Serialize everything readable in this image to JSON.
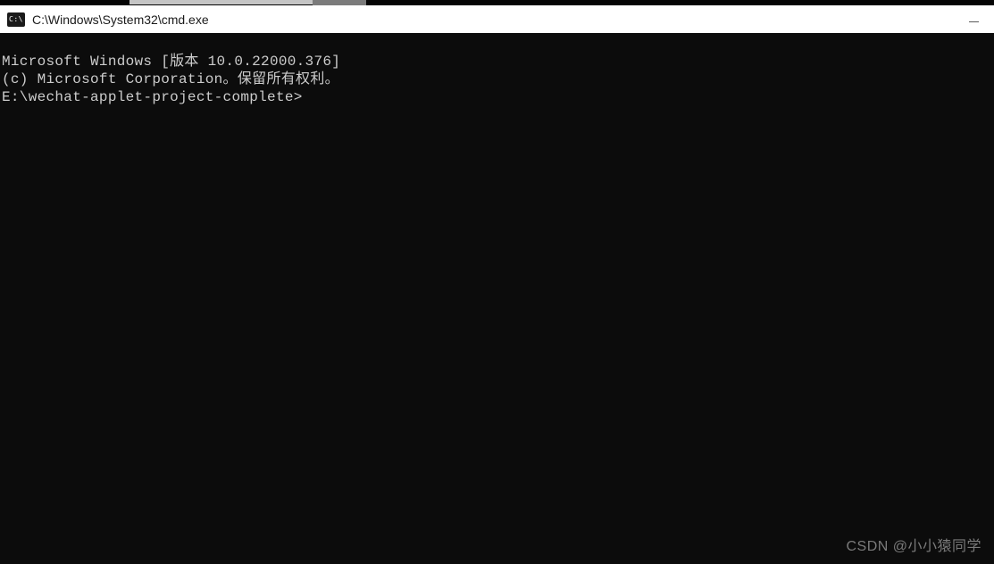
{
  "window": {
    "title": "C:\\Windows\\System32\\cmd.exe",
    "icon_label": "C:\\"
  },
  "terminal": {
    "line1": "Microsoft Windows [版本 10.0.22000.376]",
    "line2": "(c) Microsoft Corporation。保留所有权利。",
    "blank": "",
    "prompt": "E:\\wechat-applet-project-complete>"
  },
  "watermark": "CSDN @小小猿同学"
}
